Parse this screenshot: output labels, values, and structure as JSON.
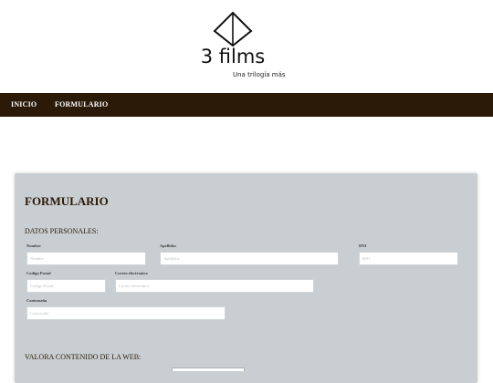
{
  "brand": {
    "title": "3 films",
    "subtitle": "Una trilogía más",
    "logo_icon": "diamond-logo-icon"
  },
  "nav": {
    "items": [
      "INICIO",
      "FORMULARIO"
    ]
  },
  "form": {
    "title": "FORMULARIO",
    "personal_section": "DATOS PERSONALES:",
    "fields": {
      "nombre": {
        "label": "Nombre",
        "placeholder": "Nombre"
      },
      "apellidos": {
        "label": "Apellidos",
        "placeholder": "Apellidos"
      },
      "dni": {
        "label": "DNI",
        "placeholder": "DNI"
      },
      "codigo_postal": {
        "label": "Codigo Postal",
        "placeholder": "Codigo Postal"
      },
      "correo": {
        "label": "Correo electronico",
        "placeholder": "Correo electronico"
      },
      "contrasena": {
        "label": "Contraseña",
        "placeholder": "Contraseña"
      }
    },
    "rating_section": "VALORA CONTENIDO DE LA WEB:"
  },
  "colors": {
    "nav_bg": "#2b1a07",
    "panel_bg": "#c8ced1",
    "title_text": "#2b1a07"
  }
}
